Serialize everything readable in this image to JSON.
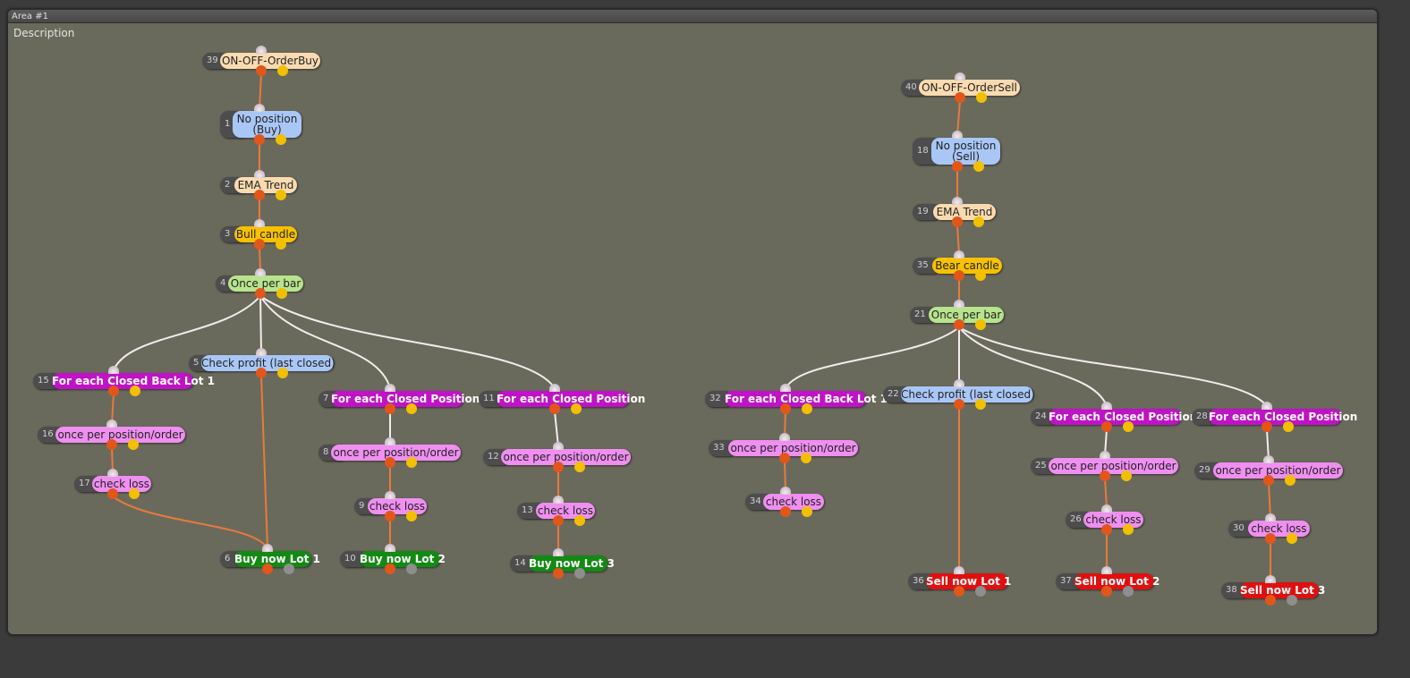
{
  "area": {
    "title": "Area #1",
    "description": "Description"
  },
  "colors": {
    "orange_link": "#e87a3c",
    "white_link": "#f4ecec",
    "peach": "#fadbb0",
    "blue": "#a9c7f6",
    "gold": "#f7c100",
    "green_light": "#b7e48c",
    "magenta": "#c012c6",
    "pink": "#ef8ff0",
    "green_dark": "#138a13",
    "red": "#e01010"
  },
  "nodes": [
    {
      "id": "39",
      "label": "ON-OFF-OrderBuy",
      "style": "peach"
    },
    {
      "id": "1",
      "label": "No position\n(Buy)",
      "style": "blue"
    },
    {
      "id": "2",
      "label": "EMA Trend",
      "style": "peach"
    },
    {
      "id": "3",
      "label": "Bull candle",
      "style": "gold"
    },
    {
      "id": "4",
      "label": "Once per bar",
      "style": "green_light"
    },
    {
      "id": "15",
      "label": "For each Closed Back Lot 1",
      "style": "magenta"
    },
    {
      "id": "5",
      "label": "Check profit (last closed)",
      "style": "blue"
    },
    {
      "id": "7",
      "label": "For each Closed Position",
      "style": "magenta"
    },
    {
      "id": "11",
      "label": "For each Closed Position",
      "style": "magenta"
    },
    {
      "id": "16",
      "label": "once per position/order",
      "style": "pink"
    },
    {
      "id": "8",
      "label": "once per position/order",
      "style": "pink"
    },
    {
      "id": "12",
      "label": "once per position/order",
      "style": "pink"
    },
    {
      "id": "17",
      "label": "check loss",
      "style": "pink"
    },
    {
      "id": "9",
      "label": "check loss",
      "style": "pink"
    },
    {
      "id": "13",
      "label": "check loss",
      "style": "pink"
    },
    {
      "id": "6",
      "label": "Buy now Lot 1",
      "style": "green_dark"
    },
    {
      "id": "10",
      "label": "Buy now Lot 2",
      "style": "green_dark"
    },
    {
      "id": "14",
      "label": "Buy now Lot 3",
      "style": "green_dark"
    },
    {
      "id": "40",
      "label": "ON-OFF-OrderSell",
      "style": "peach"
    },
    {
      "id": "18",
      "label": "No position\n(Sell)",
      "style": "blue"
    },
    {
      "id": "19",
      "label": "EMA Trend",
      "style": "peach"
    },
    {
      "id": "35",
      "label": "Bear candle",
      "style": "gold"
    },
    {
      "id": "21",
      "label": "Once per bar",
      "style": "green_light"
    },
    {
      "id": "32",
      "label": "For each Closed Back Lot 1",
      "style": "magenta"
    },
    {
      "id": "22",
      "label": "Check profit (last closed)",
      "style": "blue"
    },
    {
      "id": "24",
      "label": "For each Closed Position",
      "style": "magenta"
    },
    {
      "id": "28",
      "label": "For each Closed Position",
      "style": "magenta"
    },
    {
      "id": "33",
      "label": "once per position/order",
      "style": "pink"
    },
    {
      "id": "25",
      "label": "once per position/order",
      "style": "pink"
    },
    {
      "id": "29",
      "label": "once per position/order",
      "style": "pink"
    },
    {
      "id": "34",
      "label": "check loss",
      "style": "pink"
    },
    {
      "id": "26",
      "label": "check loss",
      "style": "pink"
    },
    {
      "id": "30",
      "label": "check loss",
      "style": "pink"
    },
    {
      "id": "36",
      "label": "Sell now Lot 1",
      "style": "red"
    },
    {
      "id": "37",
      "label": "Sell now Lot 2",
      "style": "red"
    },
    {
      "id": "38",
      "label": "Sell now Lot 3",
      "style": "red"
    }
  ],
  "links": [
    {
      "from": "39",
      "to": "1",
      "color": "orange"
    },
    {
      "from": "1",
      "to": "2",
      "color": "orange"
    },
    {
      "from": "2",
      "to": "3",
      "color": "orange"
    },
    {
      "from": "3",
      "to": "4",
      "color": "orange"
    },
    {
      "from": "4",
      "to": "15",
      "color": "white"
    },
    {
      "from": "4",
      "to": "5",
      "color": "white"
    },
    {
      "from": "4",
      "to": "7",
      "color": "white"
    },
    {
      "from": "4",
      "to": "11",
      "color": "white"
    },
    {
      "from": "15",
      "to": "16",
      "color": "orange"
    },
    {
      "from": "16",
      "to": "17",
      "color": "orange"
    },
    {
      "from": "17",
      "to": "6",
      "color": "orange"
    },
    {
      "from": "5",
      "to": "6",
      "color": "orange"
    },
    {
      "from": "7",
      "to": "8",
      "color": "white"
    },
    {
      "from": "8",
      "to": "9",
      "color": "orange"
    },
    {
      "from": "9",
      "to": "10",
      "color": "orange"
    },
    {
      "from": "11",
      "to": "12",
      "color": "white"
    },
    {
      "from": "12",
      "to": "13",
      "color": "orange"
    },
    {
      "from": "13",
      "to": "14",
      "color": "orange"
    },
    {
      "from": "40",
      "to": "18",
      "color": "orange"
    },
    {
      "from": "18",
      "to": "19",
      "color": "orange"
    },
    {
      "from": "19",
      "to": "35",
      "color": "orange"
    },
    {
      "from": "35",
      "to": "21",
      "color": "orange"
    },
    {
      "from": "21",
      "to": "32",
      "color": "white"
    },
    {
      "from": "21",
      "to": "22",
      "color": "white"
    },
    {
      "from": "21",
      "to": "24",
      "color": "white"
    },
    {
      "from": "21",
      "to": "28",
      "color": "white"
    },
    {
      "from": "32",
      "to": "33",
      "color": "orange"
    },
    {
      "from": "33",
      "to": "34",
      "color": "orange"
    },
    {
      "from": "22",
      "to": "36",
      "color": "orange"
    },
    {
      "from": "24",
      "to": "25",
      "color": "white"
    },
    {
      "from": "25",
      "to": "26",
      "color": "orange"
    },
    {
      "from": "26",
      "to": "37",
      "color": "orange"
    },
    {
      "from": "28",
      "to": "29",
      "color": "white"
    },
    {
      "from": "29",
      "to": "30",
      "color": "orange"
    },
    {
      "from": "30",
      "to": "38",
      "color": "orange"
    }
  ]
}
